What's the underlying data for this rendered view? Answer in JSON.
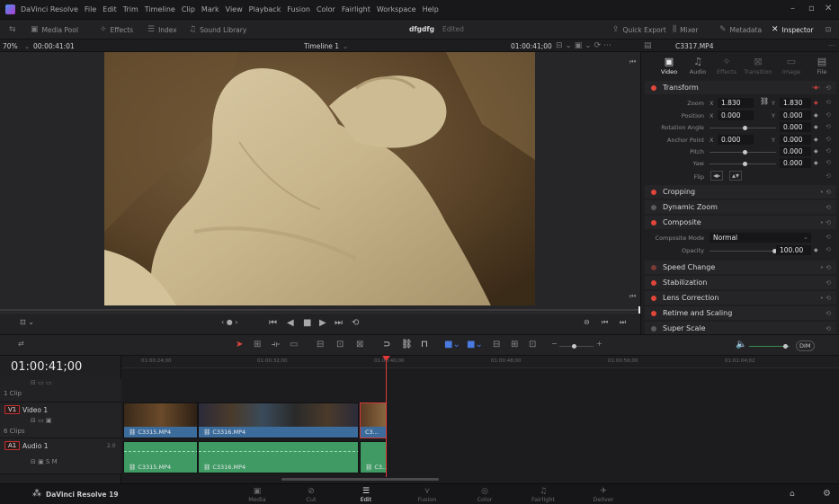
{
  "app": {
    "name": "DaVinci Resolve",
    "project": "dfgdfg",
    "status": "Edited"
  },
  "menu": [
    "File",
    "Edit",
    "Trim",
    "Timeline",
    "Clip",
    "Mark",
    "View",
    "Playback",
    "Fusion",
    "Color",
    "Fairlight",
    "Workspace",
    "Help"
  ],
  "toolbar": {
    "media_pool": "Media Pool",
    "effects": "Effects",
    "index": "Index",
    "sound_library": "Sound Library",
    "quick_export": "Quick Export",
    "mixer": "Mixer",
    "metadata": "Metadata",
    "inspector": "Inspector"
  },
  "viewer": {
    "zoom": "70%",
    "source_tc": "00:00:41:01",
    "timeline_name": "Timeline 1",
    "record_tc": "01:00:41;00",
    "clip_name": "C3317.MP4"
  },
  "inspector": {
    "tabs": [
      "Video",
      "Audio",
      "Effects",
      "Transition",
      "Image",
      "File"
    ],
    "transform": {
      "title": "Transform",
      "zoom_label": "Zoom",
      "zoom_x": "1.830",
      "zoom_y": "1.830",
      "position_label": "Position",
      "position_x": "0.000",
      "position_y": "0.000",
      "rotation_label": "Rotation Angle",
      "rotation": "0.000",
      "anchor_label": "Anchor Point",
      "anchor_x": "0.000",
      "anchor_y": "0.000",
      "pitch_label": "Pitch",
      "pitch": "0.000",
      "yaw_label": "Yaw",
      "yaw": "0.000",
      "flip_label": "Flip"
    },
    "sections": {
      "cropping": "Cropping",
      "dynamic_zoom": "Dynamic Zoom",
      "composite": "Composite",
      "speed_change": "Speed Change",
      "stabilization": "Stabilization",
      "lens_correction": "Lens Correction",
      "retime_scaling": "Retime and Scaling",
      "super_scale": "Super Scale"
    },
    "composite": {
      "mode_label": "Composite Mode",
      "mode": "Normal",
      "opacity_label": "Opacity",
      "opacity": "100.00"
    }
  },
  "timeline": {
    "timecode": "01:00:41;00",
    "ruler": [
      "01:00:24;00",
      "01:00:32;00",
      "01:00:40;00",
      "01:00:48;00",
      "01:00:56;00",
      "01:01:04;02"
    ],
    "volume_label": "DIM",
    "tracks": {
      "top_clips": "1 Clip",
      "v1_badge": "V1",
      "v1_name": "Video 1",
      "v1_clips": "6 Clips",
      "a1_badge": "A1",
      "a1_name": "Audio 1",
      "a1_level": "2.0"
    },
    "clips": {
      "v1": [
        "C3315.MP4",
        "C3316.MP4",
        "C3..."
      ],
      "a1": [
        "C3315.MP4",
        "C3316.MP4",
        "C3..."
      ]
    }
  },
  "pagebar": {
    "brand": "DaVinci Resolve 19",
    "pages": [
      "Media",
      "Cut",
      "Edit",
      "Fusion",
      "Color",
      "Fairlight",
      "Deliver"
    ],
    "active": "Edit"
  },
  "colors": {
    "accent": "#e0463a",
    "video_clip": "#3c6c9c",
    "audio_clip": "#3f9a63",
    "playhead": "#e03a3a"
  }
}
